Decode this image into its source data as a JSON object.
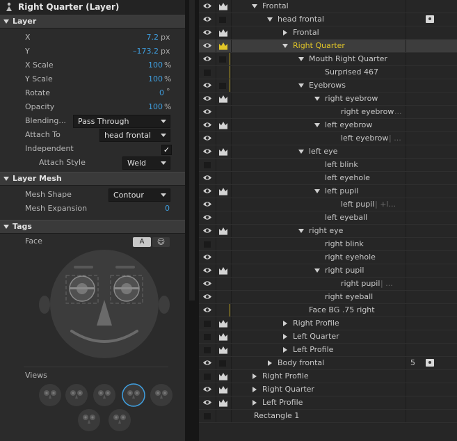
{
  "title": "Right Quarter (Layer)",
  "sections": {
    "layer": "Layer",
    "mesh": "Layer Mesh",
    "tags": "Tags"
  },
  "props": {
    "x": {
      "label": "X",
      "value": "7.2",
      "unit": "px"
    },
    "y": {
      "label": "Y",
      "value": "–173.2",
      "unit": "px"
    },
    "xscale": {
      "label": "X Scale",
      "value": "100",
      "unit": "%"
    },
    "yscale": {
      "label": "Y Scale",
      "value": "100",
      "unit": "%"
    },
    "rotate": {
      "label": "Rotate",
      "value": "0",
      "unit": "°"
    },
    "opacity": {
      "label": "Opacity",
      "value": "100",
      "unit": "%"
    },
    "blending": {
      "label": "Blending...",
      "value": "Pass Through"
    },
    "attach": {
      "label": "Attach To",
      "value": "head frontal"
    },
    "independent": {
      "label": "Independent",
      "checked": "✓"
    },
    "attachstyle": {
      "label": "Attach Style",
      "value": "Weld"
    },
    "meshshape": {
      "label": "Mesh Shape",
      "value": "Contour"
    },
    "meshexp": {
      "label": "Mesh Expansion",
      "value": "0"
    }
  },
  "tags": {
    "face": "Face",
    "btn_a": "A",
    "btn_smile": "☺",
    "views": "Views"
  },
  "colors": {
    "accent": "#3f9fe0",
    "highlight": "#e2c628",
    "panel": "#2b2b2b"
  },
  "tree": [
    {
      "label": "Frontal",
      "indent": 78,
      "tri": "down",
      "vis": "eye",
      "crown": true
    },
    {
      "label": "head frontal",
      "indent": 100,
      "tri": "down",
      "vis": "eye",
      "crown": false,
      "cam": true
    },
    {
      "label": "Frontal",
      "indent": 122,
      "tri": "right",
      "vis": "eye",
      "crown": true
    },
    {
      "label": "Right Quarter",
      "indent": 122,
      "tri": "down",
      "vis": "eye",
      "crown": true,
      "selected": true
    },
    {
      "label": "Mouth Right Quarter",
      "indent": 145,
      "tri": "down",
      "vis": "eye",
      "crown": false
    },
    {
      "label": "Surprised 467",
      "indent": 168,
      "tri": "none",
      "vis": "sq",
      "crown": "none"
    },
    {
      "label": "Eyebrows",
      "indent": 145,
      "tri": "down",
      "vis": "eye",
      "crown": false
    },
    {
      "label": "right eyebrow",
      "indent": 168,
      "tri": "down",
      "vis": "eye",
      "crown": true
    },
    {
      "label": "right eyebrow",
      "indent": 191,
      "tri": "none",
      "vis": "eye",
      "crown": "none",
      "dim": "..."
    },
    {
      "label": "left eyebrow",
      "indent": 168,
      "tri": "down",
      "vis": "eye",
      "crown": true
    },
    {
      "label": "left eyebrow",
      "indent": 191,
      "tri": "none",
      "vis": "eye",
      "crown": "none",
      "dim": " | ..."
    },
    {
      "label": "left eye",
      "indent": 145,
      "tri": "down",
      "vis": "eye",
      "crown": true
    },
    {
      "label": "left blink",
      "indent": 168,
      "tri": "none",
      "vis": "sq",
      "crown": "none"
    },
    {
      "label": "left eyehole",
      "indent": 168,
      "tri": "none",
      "vis": "eye",
      "crown": "none"
    },
    {
      "label": "left pupil",
      "indent": 168,
      "tri": "down",
      "vis": "eye",
      "crown": true
    },
    {
      "label": "left pupil",
      "indent": 191,
      "tri": "none",
      "vis": "eye",
      "crown": "none",
      "dim": " | +l..."
    },
    {
      "label": "left eyeball",
      "indent": 168,
      "tri": "none",
      "vis": "eye",
      "crown": "none"
    },
    {
      "label": "right eye",
      "indent": 145,
      "tri": "down",
      "vis": "eye",
      "crown": true
    },
    {
      "label": "right blink",
      "indent": 168,
      "tri": "none",
      "vis": "sq",
      "crown": "none"
    },
    {
      "label": "right eyehole",
      "indent": 168,
      "tri": "none",
      "vis": "eye",
      "crown": "none"
    },
    {
      "label": "right pupil",
      "indent": 168,
      "tri": "down",
      "vis": "eye",
      "crown": true
    },
    {
      "label": "right pupil",
      "indent": 191,
      "tri": "none",
      "vis": "eye",
      "crown": "none",
      "dim": " | ..."
    },
    {
      "label": "right eyeball",
      "indent": 168,
      "tri": "none",
      "vis": "eye",
      "crown": "none"
    },
    {
      "label": "Face BG .75 right",
      "indent": 145,
      "tri": "none",
      "vis": "eye",
      "crown": "none"
    },
    {
      "label": "Right Profile",
      "indent": 122,
      "tri": "right",
      "vis": "sq",
      "crown": true
    },
    {
      "label": "Left Quarter",
      "indent": 122,
      "tri": "right",
      "vis": "sq",
      "crown": true
    },
    {
      "label": "Left Profile",
      "indent": 122,
      "tri": "right",
      "vis": "sq",
      "crown": true
    },
    {
      "label": "Body frontal",
      "indent": 100,
      "tri": "right",
      "vis": "eye",
      "crown": false,
      "num": "5",
      "cam": true
    },
    {
      "label": "Right Profile",
      "indent": 78,
      "tri": "right",
      "vis": "sq",
      "crown": true
    },
    {
      "label": "Right Quarter",
      "indent": 78,
      "tri": "right",
      "vis": "eye",
      "crown": true
    },
    {
      "label": "Left Profile",
      "indent": 78,
      "tri": "right",
      "vis": "eye",
      "crown": true
    },
    {
      "label": "Rectangle 1",
      "indent": 66,
      "tri": "none",
      "vis": "sq",
      "crown": "none"
    }
  ]
}
